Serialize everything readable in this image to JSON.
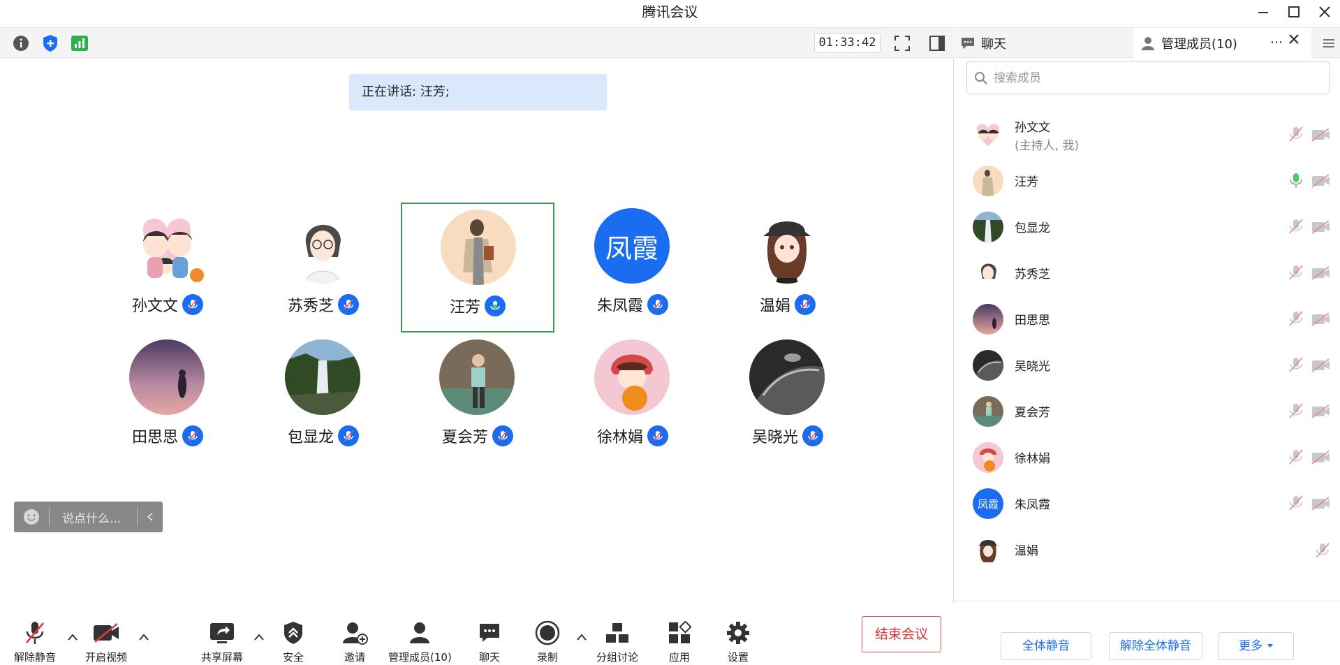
{
  "window": {
    "title": "腾讯会议"
  },
  "meeting": {
    "timer": "01:33:42",
    "speaking_label": "正在讲话: 汪芳;"
  },
  "participants": [
    {
      "name": "孙文文"
    },
    {
      "name": "苏秀芝"
    },
    {
      "name": "汪芳"
    },
    {
      "name": "朱凤霞",
      "avatar_text": "凤霞"
    },
    {
      "name": "温娟"
    },
    {
      "name": "田思思"
    },
    {
      "name": "包显龙"
    },
    {
      "name": "夏会芳"
    },
    {
      "name": "徐林娟"
    },
    {
      "name": "吴晓光"
    }
  ],
  "chat_input": {
    "placeholder": "说点什么..."
  },
  "toolbar": {
    "unmute": "解除静音",
    "start_video": "开启视频",
    "share_screen": "共享屏幕",
    "security": "安全",
    "invite": "邀请",
    "manage_members": "管理成员(10)",
    "chat": "聊天",
    "record": "录制",
    "breakout": "分组讨论",
    "apps": "应用",
    "settings": "设置",
    "end_meeting": "结束会议"
  },
  "panel": {
    "tab_chat": "聊天",
    "tab_members": "管理成员(10)",
    "search_placeholder": "搜索成员",
    "members": [
      {
        "name": "孙文文",
        "sub": "(主持人, 我)"
      },
      {
        "name": "汪芳"
      },
      {
        "name": "包显龙"
      },
      {
        "name": "苏秀芝"
      },
      {
        "name": "田思思"
      },
      {
        "name": "吴晓光"
      },
      {
        "name": "夏会芳"
      },
      {
        "name": "徐林娟"
      },
      {
        "name": "朱凤霞",
        "avatar_text": "凤霞"
      },
      {
        "name": "温娟"
      }
    ],
    "mute_all": "全体静音",
    "unmute_all": "解除全体静音",
    "more": "更多"
  },
  "colors": {
    "accent": "#1a6cf0",
    "speaking_border": "#2ba24c",
    "end_red": "#d33333"
  }
}
